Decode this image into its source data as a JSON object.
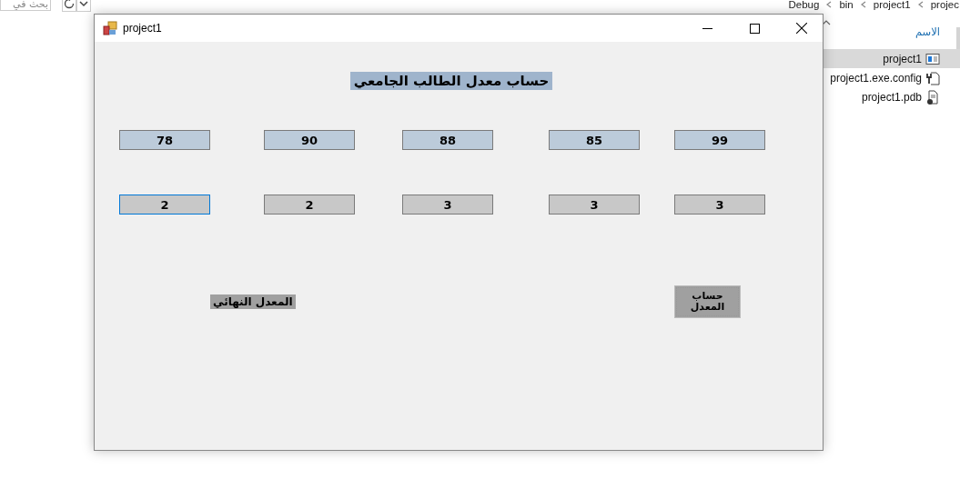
{
  "explorer": {
    "search": {
      "placeholder": "بحث في"
    },
    "breadcrumb": [
      "projec",
      "project1",
      "bin",
      "Debug"
    ],
    "column_header": "الاسم",
    "files": [
      {
        "name": "project1",
        "kind": "app",
        "selected": true
      },
      {
        "name": "project1.exe.config",
        "kind": "config",
        "selected": false
      },
      {
        "name": "project1.pdb",
        "kind": "pdb",
        "selected": false
      }
    ]
  },
  "window": {
    "title": "project1",
    "heading": "حساب معدل الطالب الجامعي",
    "grades": [
      {
        "value": "99",
        "focused": false
      },
      {
        "value": "85",
        "focused": false
      },
      {
        "value": "88",
        "focused": false
      },
      {
        "value": "90",
        "focused": false
      },
      {
        "value": "78",
        "focused": false
      }
    ],
    "hours": [
      {
        "value": "3",
        "focused": false
      },
      {
        "value": "3",
        "focused": false
      },
      {
        "value": "3",
        "focused": false
      },
      {
        "value": "2",
        "focused": false
      },
      {
        "value": "2",
        "focused": true
      }
    ],
    "result_label": "المعدل النهائي",
    "button": "حساب المعدل"
  }
}
